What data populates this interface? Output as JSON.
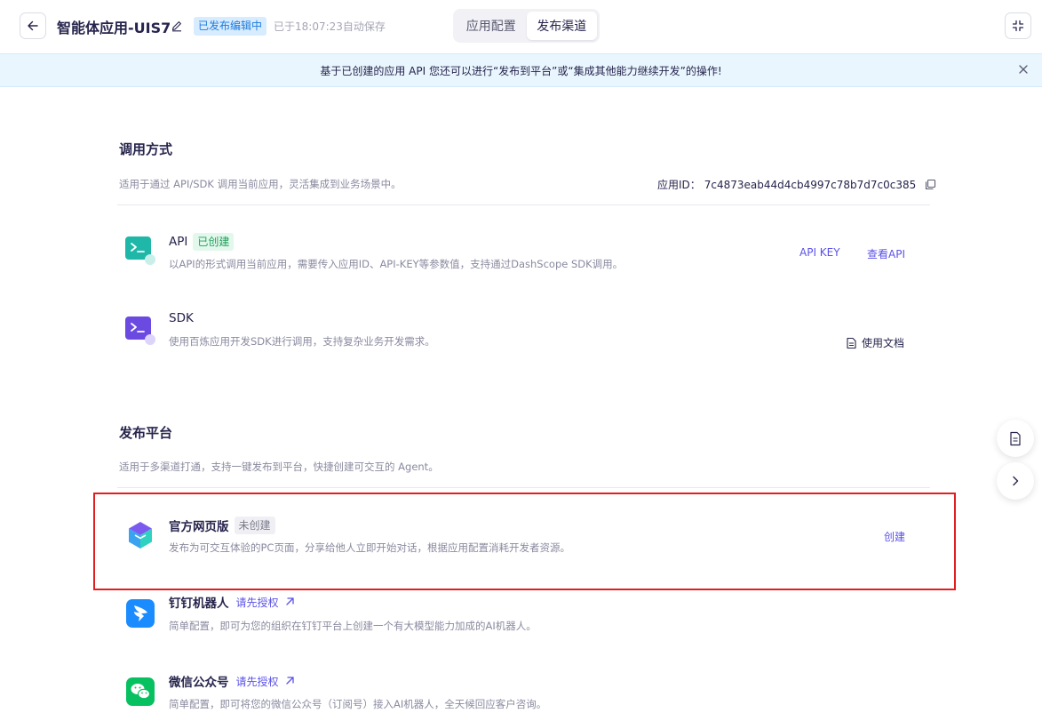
{
  "header": {
    "title": "智能体应用-UIS7",
    "status_badge": "已发布编辑中",
    "autosave": "已于18:07:23自动保存",
    "tabs": [
      {
        "label": "应用配置",
        "active": false
      },
      {
        "label": "发布渠道",
        "active": true
      }
    ]
  },
  "notice": {
    "text": "基于已创建的应用 API 您还可以进行“发布到平台”或“集成其他能力继续开发”的操作!"
  },
  "invoke": {
    "title": "调用方式",
    "desc": "适用于通过 API/SDK 调用当前应用，灵活集成到业务场景中。",
    "app_id_label": "应用ID：",
    "app_id": "7c4873eab44d4cb4997c78b7d7c0c385",
    "items": [
      {
        "name": "API",
        "tag": "已创建",
        "desc": "以API的形式调用当前应用，需要传入应用ID、API-KEY等参数值，支持通过DashScope SDK调用。",
        "actions": [
          "API KEY",
          "查看API"
        ]
      },
      {
        "name": "SDK",
        "desc": "使用百炼应用开发SDK进行调用，支持复杂业务开发需求。",
        "actions": [
          "使用文档"
        ]
      }
    ]
  },
  "publish": {
    "title": "发布平台",
    "desc": "适用于多渠道打通，支持一键发布到平台，快捷创建可交互的 Agent。",
    "items": [
      {
        "name": "官方网页版",
        "tag": "未创建",
        "desc": "发布为可交互体验的PC页面，分享给他人立即开始对话，根据应用配置消耗开发者资源。",
        "action": "创建"
      },
      {
        "name": "钉钉机器人",
        "auth": "请先授权",
        "desc": "简单配置，即可为您的组织在钉钉平台上创建一个有大模型能力加成的AI机器人。"
      },
      {
        "name": "微信公众号",
        "auth": "请先授权",
        "desc": "简单配置，即可将您的微信公众号（订阅号）接入AI机器人，全天候回应客户咨询。"
      }
    ]
  },
  "colors": {
    "accent": "#5b52e8",
    "highlight": "#e02020",
    "notice_bg": "#e9f6fe"
  },
  "icons": [
    "back-arrow-icon",
    "edit-icon",
    "fullscreen-exit-icon",
    "close-icon",
    "copy-icon",
    "terminal-icon",
    "document-icon",
    "external-link-icon",
    "chevron-right-icon",
    "dingtalk-icon",
    "wechat-icon",
    "web-cube-icon"
  ]
}
